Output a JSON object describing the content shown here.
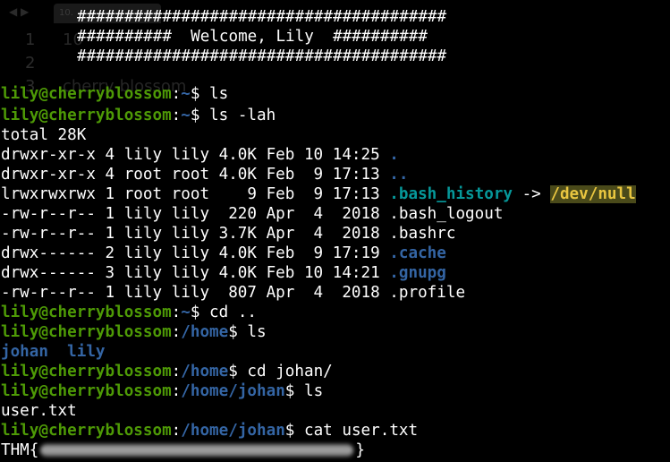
{
  "editor_ghost": {
    "tab_label": "10.",
    "line_numbers": [
      "1",
      "2",
      "3"
    ],
    "line_1_text": "10",
    "line_3_text": "cherry-blossom"
  },
  "banner": {
    "border": "#######################################",
    "welcome": "##########  Welcome, Lily  ##########"
  },
  "prompt": {
    "user_host": "lily@cherryblossom",
    "colon": ":",
    "sep": "$ "
  },
  "session": {
    "cmd_ls_1": {
      "path": "~",
      "command": "ls"
    },
    "cmd_ls_lah": {
      "path": "~",
      "command": "ls -lah"
    },
    "total": "total 28K",
    "listing": [
      {
        "perm_text": "drwxr-xr-x 4 lily lily 4.0K Feb 10 14:25 ",
        "name": ".",
        "style": "dir"
      },
      {
        "perm_text": "drwxr-xr-x 4 root root 4.0K Feb  9 17:13 ",
        "name": "..",
        "style": "dir"
      },
      {
        "perm_text": "lrwxrwxrwx 1 root root    9 Feb  9 17:13 ",
        "name": ".bash_history",
        "style": "cyan",
        "arrow": " -> ",
        "target": "/dev/null"
      },
      {
        "perm_text": "-rw-r--r-- 1 lily lily  220 Apr  4  2018 ",
        "name": ".bash_logout",
        "style": "plain"
      },
      {
        "perm_text": "-rw-r--r-- 1 lily lily 3.7K Apr  4  2018 ",
        "name": ".bashrc",
        "style": "plain"
      },
      {
        "perm_text": "drwx------ 2 lily lily 4.0K Feb  9 17:19 ",
        "name": ".cache",
        "style": "dir"
      },
      {
        "perm_text": "drwx------ 3 lily lily 4.0K Feb 10 14:21 ",
        "name": ".gnupg",
        "style": "dir"
      },
      {
        "perm_text": "-rw-r--r-- 1 lily lily  807 Apr  4  2018 ",
        "name": ".profile",
        "style": "plain"
      }
    ],
    "cmd_cd_up": {
      "path": "~",
      "command": "cd .."
    },
    "cmd_ls_home": {
      "path": "/home",
      "command": "ls"
    },
    "home_dirs": [
      "johan",
      "lily"
    ],
    "cmd_cd_johan": {
      "path": "/home",
      "command": "cd johan/"
    },
    "cmd_ls_johan": {
      "path": "/home/johan",
      "command": "ls"
    },
    "johan_files": "user.txt",
    "cmd_cat": {
      "path": "/home/johan",
      "command": "cat user.txt"
    },
    "flag_prefix": "THM{",
    "flag_suffix": "}"
  },
  "colors": {
    "background": "#000000",
    "foreground": "#ffffff",
    "user_host": "#4e9a06",
    "path": "#3465a4",
    "symlink": "#06989a",
    "symlink_target_bg": "#4a4a1a",
    "symlink_target_fg": "#e9c640"
  }
}
